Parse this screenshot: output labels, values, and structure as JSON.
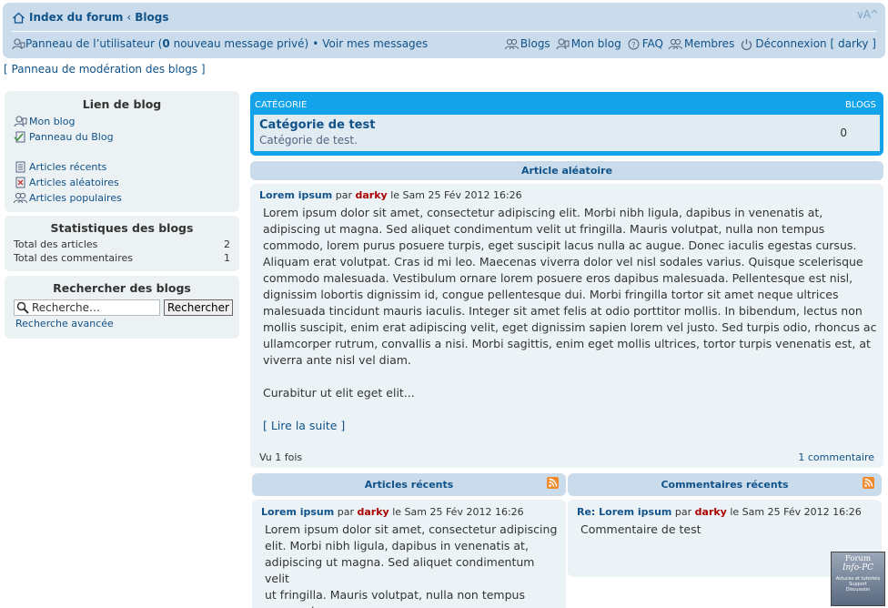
{
  "header": {
    "forum_index": "Index du forum",
    "crumb_sep": "‹",
    "blogs": "Blogs",
    "font_size_control": "∨A^",
    "user_panel_pre": "Panneau de l’utilisateur (",
    "pm_count": "0",
    "user_panel_post": " nouveau message privé)",
    "bullet": "•",
    "view_messages": "Voir mes messages",
    "nav_blogs": "Blogs",
    "nav_my_blog": "Mon blog",
    "nav_faq": "FAQ",
    "nav_members": "Membres",
    "nav_logout": "Déconnexion [ darky ]"
  },
  "mod_panel": "[ Panneau de modération des blogs ]",
  "sidebar": {
    "blog_links_title": "Lien de blog",
    "links_a": [
      "Mon blog",
      "Panneau du Blog"
    ],
    "links_b": [
      "Articles récents",
      "Articles aléatoires",
      "Articles populaires"
    ],
    "stats_title": "Statistiques des blogs",
    "stats": [
      {
        "label": "Total des articles",
        "value": "2"
      },
      {
        "label": "Total des commentaires",
        "value": "1"
      }
    ],
    "search_title": "Rechercher des blogs",
    "search_placeholder": "Recherche…",
    "search_button": "Rechercher",
    "advanced_search": "Recherche avancée"
  },
  "category": {
    "col_category": "CATÉGORIE",
    "col_blogs": "BLOGS",
    "name": "Catégorie de test",
    "description": "Catégorie de test.",
    "count": "0"
  },
  "random_article": {
    "heading": "Article aléatoire",
    "title": "Lorem ipsum",
    "by": "par",
    "author": "darky",
    "date": "le Sam 25 Fév 2012 16:26",
    "body": "Lorem ipsum dolor sit amet, consectetur adipiscing elit. Morbi nibh ligula, dapibus in venenatis at,\nadipiscing ut magna. Sed aliquet condimentum velit ut fringilla. Mauris volutpat, nulla non tempus\ncommodo, lorem purus posuere turpis, eget suscipit lacus nulla ac augue. Donec iaculis egestas cursus.\nAliquam erat volutpat. Cras id mi leo. Maecenas viverra dolor vel nisl sodales varius. Quisque scelerisque\ncommodo malesuada. Vestibulum ornare lorem posuere eros dapibus malesuada. Pellentesque est nisl,\ndignissim lobortis dignissim id, congue pellentesque dui. Morbi fringilla tortor sit amet neque ultrices\nmalesuada tincidunt mauris iaculis. Integer sit amet felis at odio porttitor mollis. In bibendum, lectus non\nmollis suscipit, enim erat adipiscing velit, eget dignissim sapien lorem vel justo. Sed turpis odio, rhoncus ac\nullamcorper rutrum, convallis a nisi. Morbi sagittis, enim eget mollis ultrices, tortor turpis venenatis est, at\nviverra ante nisl vel diam.",
    "more_text": "Curabitur ut elit eget elit...",
    "read_more": "[ Lire la suite ]",
    "views": "Vu 1 fois",
    "comments": "1 commentaire"
  },
  "recent_articles": {
    "heading": "Articles récents",
    "title": "Lorem ipsum",
    "by": "par",
    "author": "darky",
    "date": "le Sam 25 Fév 2012 16:26",
    "body": "Lorem ipsum dolor sit amet, consectetur adipiscing\nelit. Morbi nibh ligula, dapibus in venenatis at,\nadipiscing ut magna. Sed aliquet condimentum velit\nut fringilla. Mauris volutpat, nulla non tempus\ncommodo,..."
  },
  "recent_comments": {
    "heading": "Commentaires récents",
    "title": "Re: Lorem ipsum",
    "by": "par",
    "author": "darky",
    "date": "le Sam 25 Fév 2012 16:26",
    "body": "Commentaire de test"
  },
  "badge": {
    "line1": "Forum",
    "line2": "Info-PC",
    "line3": "Astuces et tutoriels\nSupport\nDiscussion"
  }
}
